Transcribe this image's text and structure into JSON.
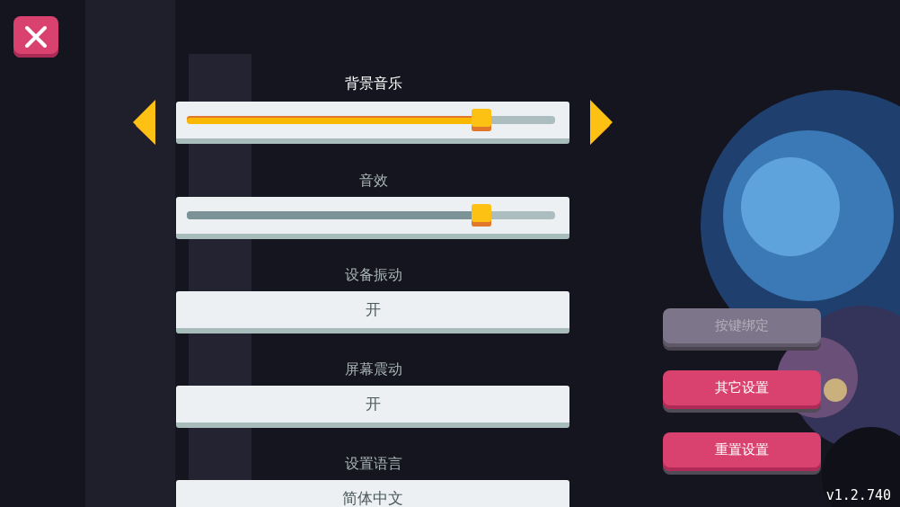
{
  "settings": [
    {
      "kind": "slider",
      "label": "背景音乐",
      "selected": true,
      "level": 0.8
    },
    {
      "kind": "slider",
      "label": "音效",
      "selected": false,
      "level": 0.8
    },
    {
      "kind": "option",
      "label": "设备振动",
      "selected": false,
      "value": "开"
    },
    {
      "kind": "option",
      "label": "屏幕震动",
      "selected": false,
      "value": "开"
    },
    {
      "kind": "option",
      "label": "设置语言",
      "selected": false,
      "value": "简体中文"
    }
  ],
  "buttons": [
    {
      "label": "按键绑定",
      "disabled": true
    },
    {
      "label": "其它设置",
      "disabled": false
    },
    {
      "label": "重置设置",
      "disabled": false
    }
  ],
  "version": "v1.2.740"
}
